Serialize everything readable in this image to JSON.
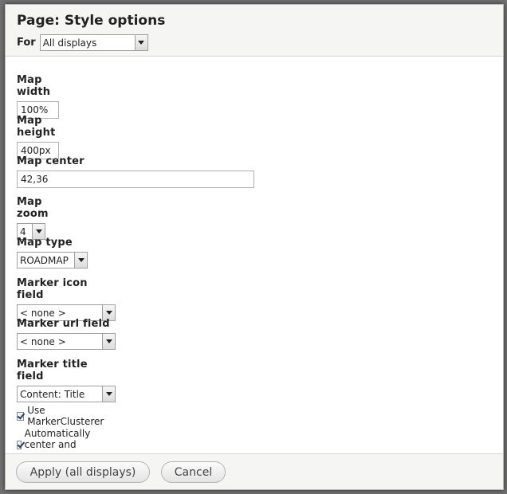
{
  "dialog": {
    "title": "Page: Style options",
    "for_label": "For",
    "for_value": "All displays"
  },
  "fields": {
    "map_width": {
      "label": "Map width",
      "value": "100%"
    },
    "map_height": {
      "label": "Map height",
      "value": "400px"
    },
    "map_center": {
      "label": "Map center",
      "value": "42,36"
    },
    "map_zoom": {
      "label": "Map zoom",
      "value": "4"
    },
    "map_type": {
      "label": "Map type",
      "value": "ROADMAP"
    },
    "marker_icon_field": {
      "label": "Marker icon field",
      "value": "< none >"
    },
    "marker_url_field": {
      "label": "Marker url field",
      "value": "< none >"
    },
    "marker_title_field": {
      "label": "Marker title field",
      "value": "Content: Title"
    }
  },
  "checkboxes": {
    "use_markerclusterer": {
      "label": "Use MarkerClusterer",
      "checked": true
    },
    "auto_center_zoom": {
      "label": "Automatically center and zoom map",
      "checked": true
    }
  },
  "footer": {
    "apply_label": "Apply (all displays)",
    "cancel_label": "Cancel"
  }
}
